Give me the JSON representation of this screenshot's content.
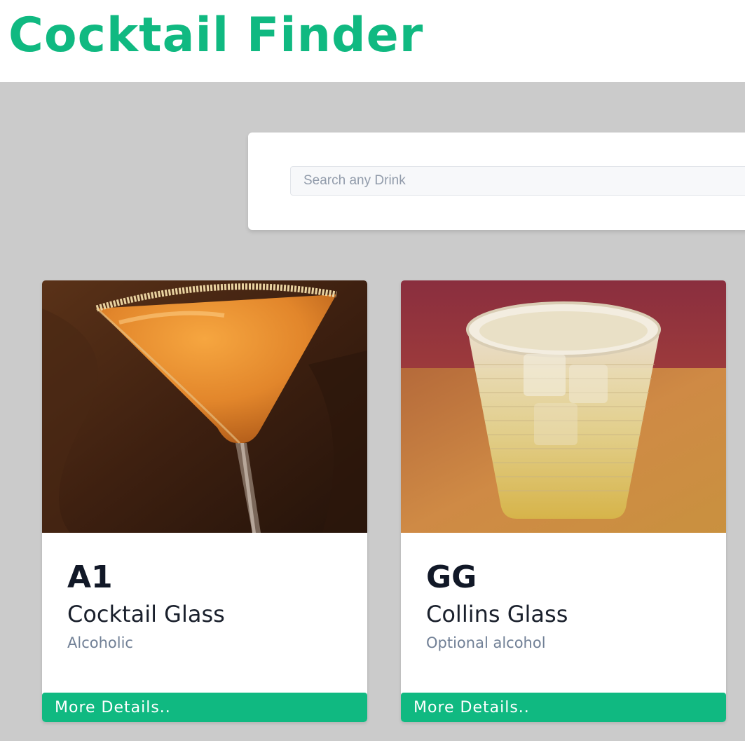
{
  "header": {
    "title": "Cocktail Finder"
  },
  "colors": {
    "brand": "#10b981",
    "page_background": "#cbcbcb"
  },
  "search": {
    "placeholder": "Search any Drink",
    "value": ""
  },
  "drinks": [
    {
      "name": "A1",
      "glass": "Cocktail Glass",
      "alcoholic": "Alcoholic",
      "button_label": "More Details..",
      "image": "orange-martini-photo"
    },
    {
      "name": "GG",
      "glass": "Collins Glass",
      "alcoholic": "Optional alcohol",
      "button_label": "More Details..",
      "image": "tumbler-on-ice-photo"
    }
  ]
}
